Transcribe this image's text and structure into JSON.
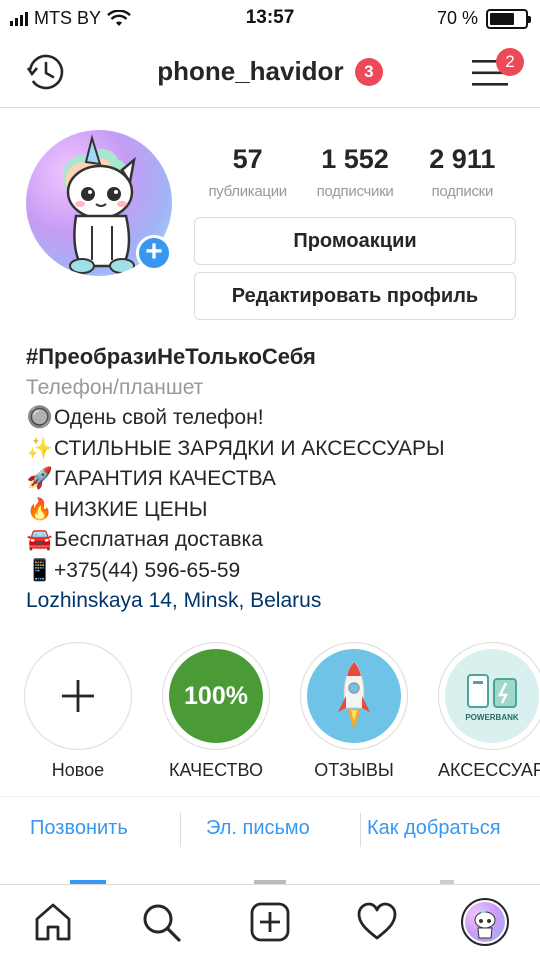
{
  "status_bar": {
    "carrier": "MTS BY",
    "time": "13:57",
    "battery": "70 %",
    "battery_level": 0.7
  },
  "header": {
    "username": "phone_havidor",
    "accounts_badge": "3",
    "menu_badge": "2"
  },
  "stats": {
    "posts": {
      "value": "57",
      "label": "публикации"
    },
    "followers": {
      "value": "1 552",
      "label": "подписчики"
    },
    "following": {
      "value": "2 911",
      "label": "подписки"
    }
  },
  "buttons": {
    "promo": "Промоакции",
    "edit": "Редактировать профиль"
  },
  "bio": {
    "name": "#ПреобразиНеТолькоСебя",
    "category": "Телефон/планшет",
    "lines": [
      {
        "emoji": "🔘",
        "text": "Одень свой телефон!"
      },
      {
        "emoji": "✨",
        "text": "СТИЛЬНЫЕ ЗАРЯДКИ И АКСЕССУАРЫ"
      },
      {
        "emoji": "🚀",
        "text": "ГАРАНТИЯ КАЧЕСТВА"
      },
      {
        "emoji": "🔥",
        "text": "НИЗКИЕ ЦЕНЫ"
      },
      {
        "emoji": "🚘",
        "text": "Бесплатная доставка"
      },
      {
        "emoji": "📱",
        "text": "+375(44) 596-65-59"
      }
    ],
    "location": "Lozhinskaya 14, Minsk, Belarus"
  },
  "highlights": [
    {
      "label": "Новое"
    },
    {
      "label": "КАЧЕСТВО",
      "inner_text": "100%"
    },
    {
      "label": "ОТЗЫВЫ"
    },
    {
      "label": "АКСЕССУАРЫ",
      "inner_text": "POWERBANK"
    }
  ],
  "contact": {
    "call": "Позвонить",
    "email": "Эл. письмо",
    "directions": "Как добраться"
  },
  "colors": {
    "accent_blue": "#3897f0",
    "badge_red": "#ed4956",
    "location_blue": "#003569",
    "muted_gray": "#999999"
  }
}
